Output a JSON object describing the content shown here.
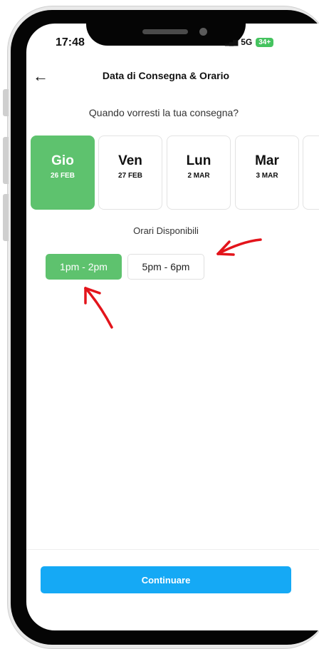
{
  "status_bar": {
    "time": "17:48",
    "network": "5G",
    "battery": "34+"
  },
  "header": {
    "back_icon": "arrow-left-icon",
    "title": "Data di Consegna & Orario"
  },
  "date_section": {
    "question": "Quando vorresti la tua consegna?",
    "dates": [
      {
        "day": "Gio",
        "date": "26 FEB",
        "selected": true
      },
      {
        "day": "Ven",
        "date": "27 FEB",
        "selected": false
      },
      {
        "day": "Lun",
        "date": "2 MAR",
        "selected": false
      },
      {
        "day": "Mar",
        "date": "3 MAR",
        "selected": false
      }
    ]
  },
  "time_section": {
    "label": "Orari Disponibili",
    "slots": [
      {
        "label": "1pm - 2pm",
        "selected": true
      },
      {
        "label": "5pm - 6pm",
        "selected": false
      }
    ]
  },
  "footer": {
    "continue_label": "Continuare"
  },
  "colors": {
    "accent_green": "#5ec26e",
    "button_blue": "#15a9f5",
    "annotation_red": "#e3141b"
  }
}
